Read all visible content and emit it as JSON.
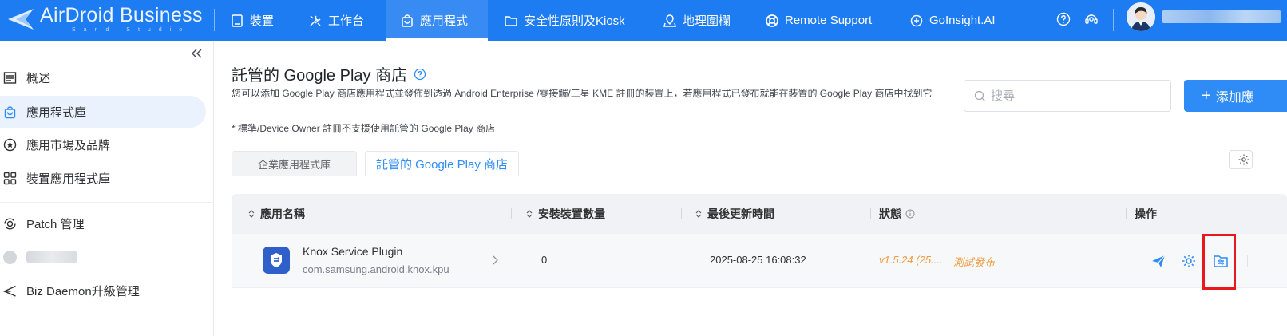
{
  "brand": {
    "title": "AirDroid Business",
    "subtitle": "Sand Studio"
  },
  "nav": [
    {
      "label": "裝置",
      "icon": "device-icon"
    },
    {
      "label": "工作台",
      "icon": "tools-icon"
    },
    {
      "label": "應用程式",
      "icon": "app-bag-icon",
      "active": true
    },
    {
      "label": "安全性原則及Kiosk",
      "icon": "folder-icon"
    },
    {
      "label": "地理圍欄",
      "icon": "geofence-icon"
    },
    {
      "label": "Remote Support",
      "icon": "lifebuoy-icon"
    },
    {
      "label": "GoInsight.AI",
      "icon": "ai-icon"
    }
  ],
  "sidebar": {
    "items": [
      {
        "label": "概述",
        "icon": "overview-icon"
      },
      {
        "label": "應用程式庫",
        "icon": "app-bag-icon",
        "active": true
      },
      {
        "label": "應用市場及品牌",
        "icon": "star-circle-icon"
      },
      {
        "label": "裝置應用程式庫",
        "icon": "grid-apps-icon"
      },
      {
        "label": "Patch 管理",
        "icon": "patch-icon"
      },
      {
        "label": "",
        "icon": "blurred-icon",
        "blurred": true
      },
      {
        "label": "Biz Daemon升級管理",
        "icon": "send-icon"
      }
    ]
  },
  "page": {
    "title": "託管的 Google Play 商店",
    "description": "您可以添加 Google Play 商店應用程式並發佈到透過 Android Enterprise /零接觸/三星 KME 註冊的裝置上，若應用程式已發布就能在裝置的 Google Play 商店中找到它",
    "note": "* 標準/Device Owner 註冊不支援使用託管的 Google Play 商店",
    "search_placeholder": "搜尋",
    "add_button": "添加應"
  },
  "tabs": [
    {
      "label": "企業應用程式庫",
      "active": false
    },
    {
      "label": "託管的 Google Play 商店",
      "active": true
    }
  ],
  "table": {
    "columns": [
      "應用名稱",
      "安裝裝置數量",
      "最後更新時間",
      "狀態",
      "操作"
    ],
    "rows": [
      {
        "name": "Knox Service Plugin",
        "package": "com.samsung.android.knox.kpu",
        "installs": "0",
        "updated": "2025-08-25 16:08:32",
        "version": "v1.5.24 (25....",
        "status": "測試發布"
      }
    ]
  },
  "colors": {
    "primary": "#1d7cf2",
    "accent": "#2f8cf6",
    "warning": "#f09a3e",
    "highlight": "#e8181b"
  }
}
